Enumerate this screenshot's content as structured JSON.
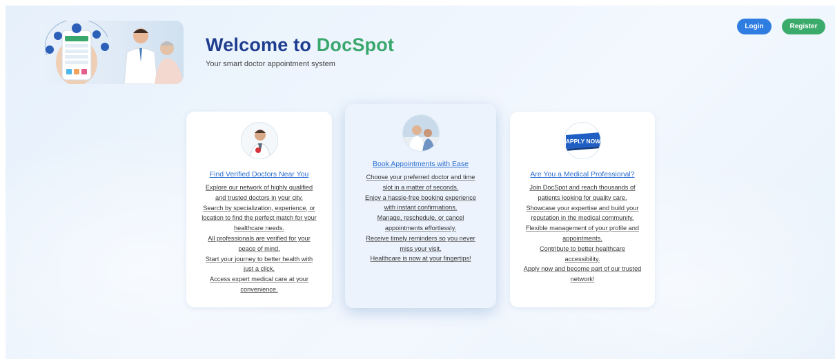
{
  "header": {
    "title_prefix": "Welcome to ",
    "title_brand": "DocSpot",
    "subtitle": "Your smart doctor appointment system",
    "hero_image": "doctor-patient-app-illustration"
  },
  "nav": {
    "login_label": "Login",
    "register_label": "Register"
  },
  "colors": {
    "primary_blue": "#1f3d8f",
    "brand_green": "#3aa76d",
    "login_button": "#2f7de1",
    "register_button": "#3bab6b",
    "card_link": "#2d6fd0"
  },
  "cards": [
    {
      "icon": "doctor-avatar",
      "title": "Find Verified Doctors Near You",
      "lines": [
        "Explore our network of highly qualified",
        "and trusted doctors in your city.",
        "Search by specialization, experience, or",
        "location to find the perfect match for your",
        "healthcare needs.",
        "All professionals are verified for your",
        "peace of mind.",
        "Start your journey to better health with",
        "just a click.",
        "Access expert medical care at your",
        "convenience."
      ]
    },
    {
      "icon": "appointment-photo",
      "title": "Book Appointments with Ease",
      "lines": [
        "Choose your preferred doctor and time",
        "slot in a matter of seconds.",
        "Enjoy a hassle-free booking experience",
        "with instant confirmations.",
        "Manage, reschedule, or cancel",
        "appointments effortlessly.",
        "Receive timely reminders so you never",
        "miss your visit.",
        "Healthcare is now at your fingertips!"
      ]
    },
    {
      "icon": "apply-now-badge",
      "badge_text": "APPLY NOW",
      "title": "Are You a Medical Professional?",
      "lines": [
        "Join DocSpot and reach thousands of",
        "patients looking for quality care.",
        "Showcase your expertise and build your",
        "reputation in the medical community.",
        "Flexible management of your profile and",
        "appointments.",
        "Contribute to better healthcare",
        "accessibility.",
        "Apply now and become part of our trusted",
        "network!"
      ]
    }
  ]
}
